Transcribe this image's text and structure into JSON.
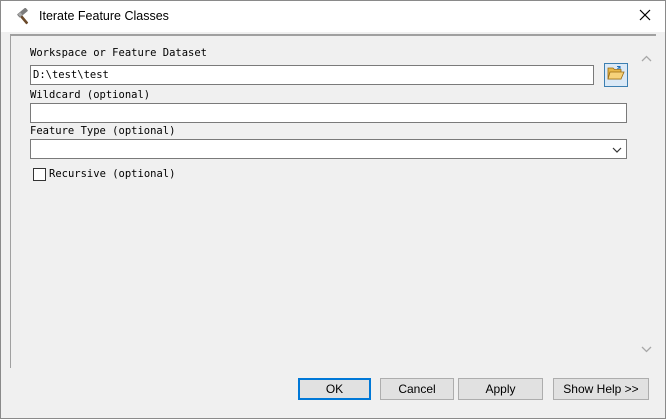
{
  "window": {
    "title": "Iterate Feature Classes",
    "icon": "hammer-icon",
    "close_icon": "close-icon"
  },
  "form": {
    "workspace": {
      "label": "Workspace or Feature Dataset",
      "value": "D:\\test\\test",
      "browse_icon": "folder-open-icon"
    },
    "wildcard": {
      "label": "Wildcard (optional)",
      "value": ""
    },
    "feature_type": {
      "label": "Feature Type (optional)",
      "value": ""
    },
    "recursive": {
      "label": "Recursive (optional)",
      "checked": false
    }
  },
  "buttons": {
    "ok": "OK",
    "cancel": "Cancel",
    "apply": "Apply",
    "show_help": "Show Help >>"
  },
  "colors": {
    "accent": "#0078d7",
    "dialog_bg": "#f0f0f0",
    "titlebar_bg": "#ffffff"
  }
}
